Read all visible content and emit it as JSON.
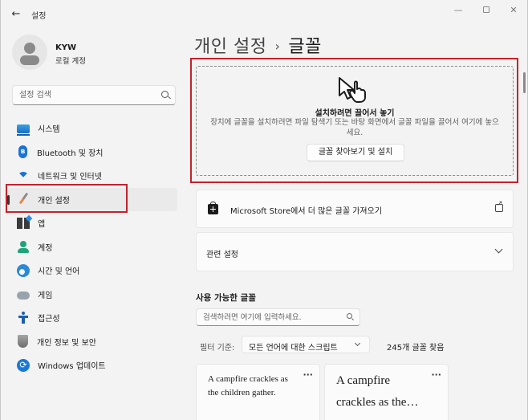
{
  "window": {
    "app_title": "설정",
    "controls": {
      "minimize": "—",
      "maximize": "",
      "close": "✕"
    }
  },
  "profile": {
    "name": "KYW",
    "account_type": "로컬 계정"
  },
  "sidebar": {
    "search_placeholder": "설정 검색",
    "items": [
      {
        "label": "시스템",
        "icon": "monitor-icon",
        "active": false
      },
      {
        "label": "Bluetooth 및 장치",
        "icon": "bluetooth-icon",
        "active": false
      },
      {
        "label": "네트워크 및 인터넷",
        "icon": "wifi-icon",
        "active": false
      },
      {
        "label": "개인 설정",
        "icon": "paintbrush-icon",
        "active": true
      },
      {
        "label": "앱",
        "icon": "apps-icon",
        "active": false
      },
      {
        "label": "계정",
        "icon": "account-icon",
        "active": false
      },
      {
        "label": "시간 및 언어",
        "icon": "clock-globe-icon",
        "active": false
      },
      {
        "label": "게임",
        "icon": "gamepad-icon",
        "active": false
      },
      {
        "label": "접근성",
        "icon": "accessibility-icon",
        "active": false
      },
      {
        "label": "개인 정보 및 보안",
        "icon": "shield-icon",
        "active": false
      },
      {
        "label": "Windows 업데이트",
        "icon": "update-icon",
        "active": false
      }
    ]
  },
  "breadcrumb": {
    "parent": "개인 설정",
    "separator": "›",
    "current": "글꼴"
  },
  "drop_zone": {
    "title": "설치하려면 끌어서 놓기",
    "description": "장치에 글꼴을 설치하려면 파일 탐색기 또는 바탕 화면에서 글꼴 파일을 끌어서 여기에 놓으세요.",
    "browse_button": "글꼴 찾아보기 및 설치"
  },
  "store_link": {
    "label": "Microsoft Store에서 더 많은 글꼴 가져오기"
  },
  "related_settings": {
    "label": "관련 설정"
  },
  "available_fonts": {
    "title": "사용 가능한 글꼴",
    "search_placeholder": "검색하려면 여기에 입력하세요.",
    "filter_label": "필터 기준:",
    "filter_value": "모든 언어에 대한 스크립트",
    "found_count": "245개 글꼴 찾음",
    "cards": [
      {
        "preview": "A campfire crackles as the children gather.",
        "more": "···"
      },
      {
        "preview": "A campfire crackles as the…",
        "more": "···"
      }
    ]
  },
  "colors": {
    "highlight_border": "#c4222c",
    "accent": "#1a73d8"
  }
}
